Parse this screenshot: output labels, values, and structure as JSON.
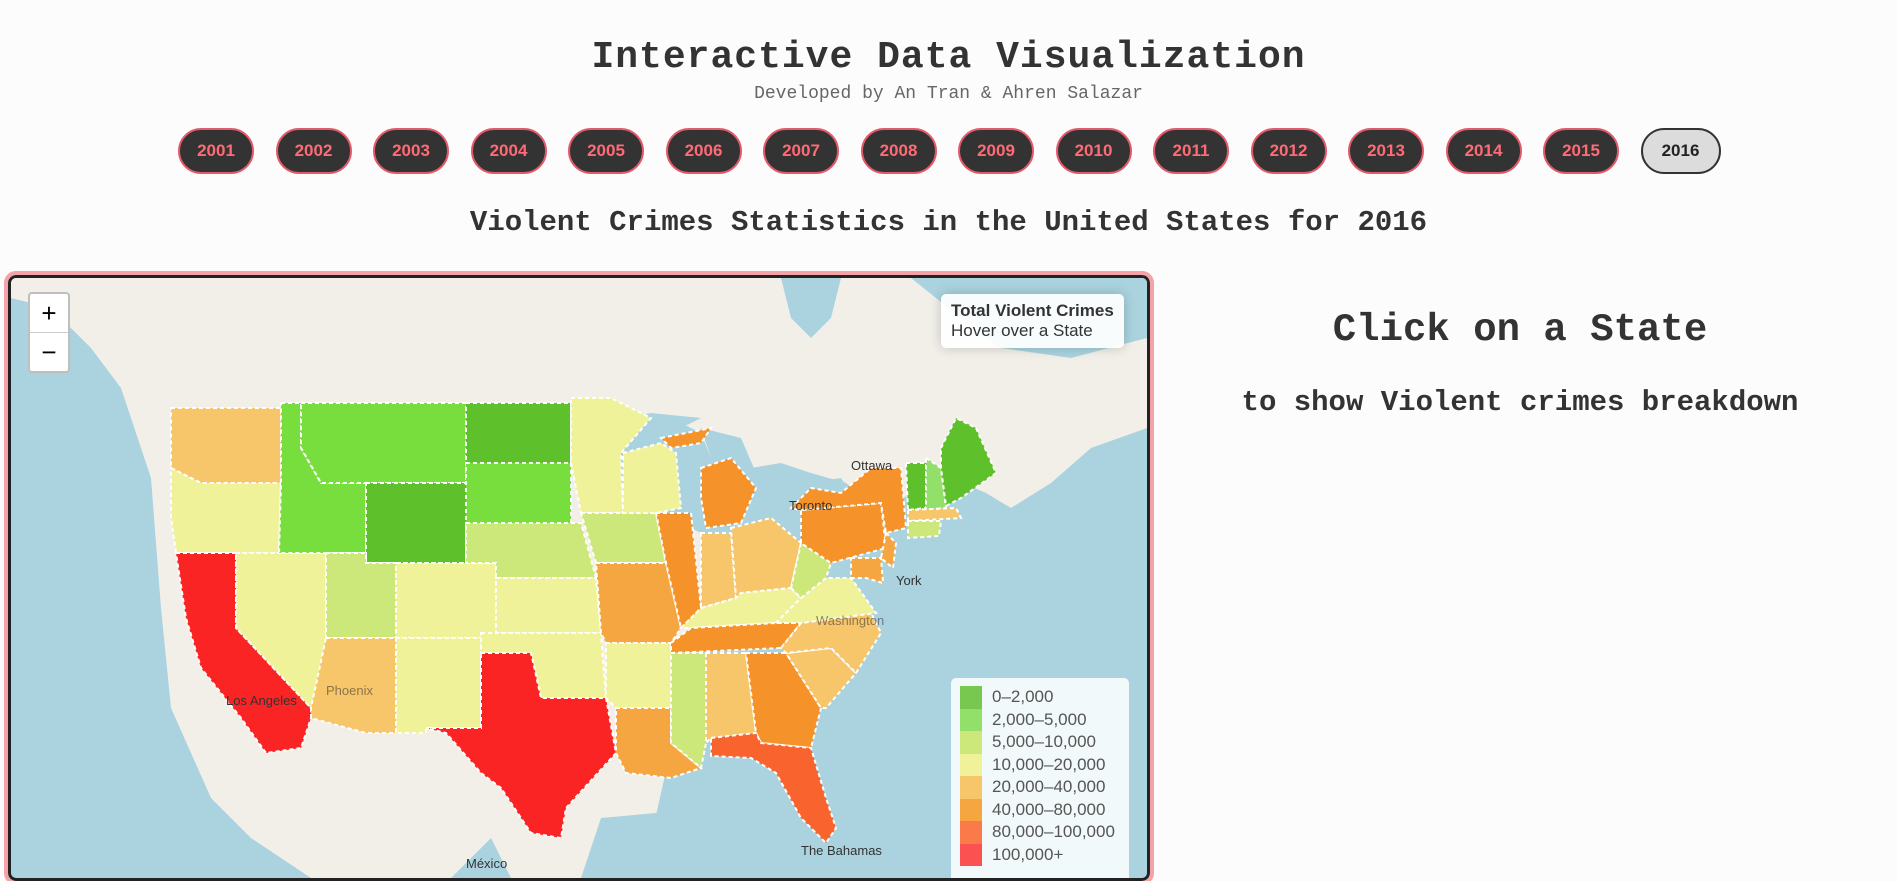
{
  "header": {
    "title": "Interactive Data Visualization",
    "subtitle": "Developed by An Tran & Ahren Salazar"
  },
  "years": [
    "2001",
    "2002",
    "2003",
    "2004",
    "2005",
    "2006",
    "2007",
    "2008",
    "2009",
    "2010",
    "2011",
    "2012",
    "2013",
    "2014",
    "2015",
    "2016"
  ],
  "selected_year": "2016",
  "heading": "Violent Crimes Statistics in the United States for 2016",
  "map": {
    "zoom_in": "+",
    "zoom_out": "−",
    "info_title": "Total Violent Crimes",
    "info_hint": "Hover over a State",
    "labels": {
      "ottawa": "Ottawa",
      "toronto": "Toronto",
      "york": "York",
      "washington": "Washington",
      "los_angeles": "Los Angeles",
      "phoenix": "Phoenix",
      "mexico": "México",
      "bahamas": "The Bahamas"
    },
    "legend": [
      {
        "label": "0–2,000",
        "color": "#78c850"
      },
      {
        "label": "2,000–5,000",
        "color": "#92e06a"
      },
      {
        "label": "5,000–10,000",
        "color": "#cde87a"
      },
      {
        "label": "10,000–20,000",
        "color": "#f0f29a"
      },
      {
        "label": "20,000–40,000",
        "color": "#f7c56a"
      },
      {
        "label": "40,000–80,000",
        "color": "#f6a640"
      },
      {
        "label": "80,000–100,000",
        "color": "#fb7a4a"
      },
      {
        "label": "100,000+",
        "color": "#fb5151"
      }
    ]
  },
  "panel": {
    "title": "Click on a State",
    "subtitle": "to show Violent crimes breakdown"
  }
}
